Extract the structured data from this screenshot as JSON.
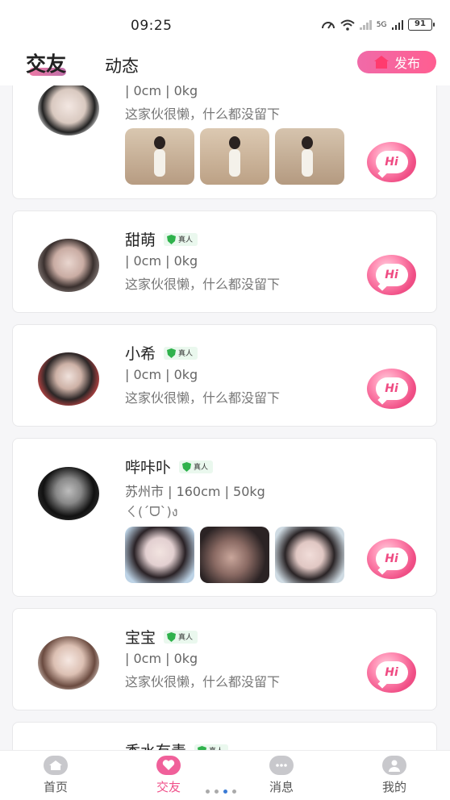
{
  "status": {
    "time": "09:25",
    "battery": "91",
    "net_label": "5G"
  },
  "header": {
    "tabs": [
      {
        "label": "交友"
      },
      {
        "label": "动态"
      }
    ],
    "publish_label": "发布"
  },
  "verified_label": "真人",
  "hi_label": "Hi",
  "profiles": [
    {
      "name": "",
      "info": "| 0cm | 0kg",
      "bio": "这家伙很懒，什么都没留下",
      "verified": false,
      "photos": 3
    },
    {
      "name": "甜萌",
      "info": "| 0cm | 0kg",
      "bio": "这家伙很懒，什么都没留下",
      "verified": true,
      "photos": 0
    },
    {
      "name": "小希",
      "info": "| 0cm | 0kg",
      "bio": "这家伙很懒，什么都没留下",
      "verified": true,
      "photos": 0
    },
    {
      "name": "哔咔卟",
      "info": "苏州市 | 160cm | 50kg",
      "bio": "ㄑ(´ᗜ`)ง",
      "verified": true,
      "photos": 3
    },
    {
      "name": "宝宝",
      "info": "| 0cm | 0kg",
      "bio": "这家伙很懒，什么都没留下",
      "verified": true,
      "photos": 0
    },
    {
      "name": "香水有毒",
      "info": "",
      "bio": "",
      "verified": true,
      "photos": 0
    }
  ],
  "bottom_nav": [
    {
      "label": "首页",
      "icon": "home-icon"
    },
    {
      "label": "交友",
      "icon": "heart-icon"
    },
    {
      "label": "消息",
      "icon": "chat-icon"
    },
    {
      "label": "我的",
      "icon": "profile-icon"
    }
  ],
  "colors": {
    "accent": "#f0508a",
    "verified_green": "#2fb24c"
  }
}
